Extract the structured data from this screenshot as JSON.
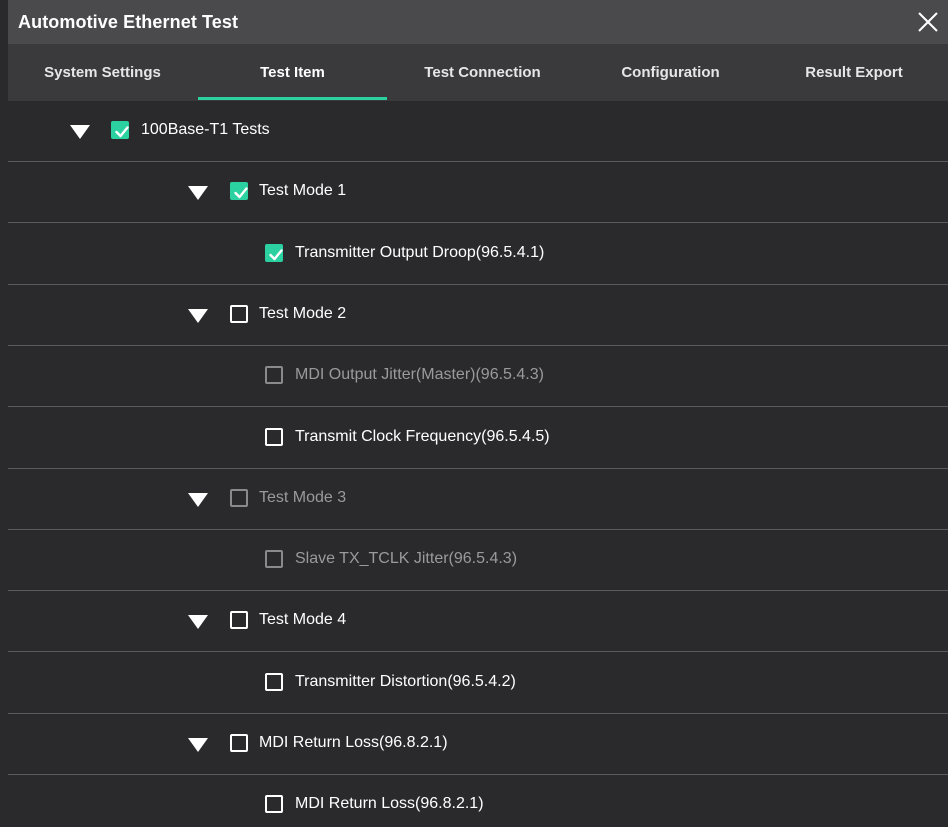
{
  "window": {
    "title": "Automotive Ethernet Test",
    "close_icon": "close-icon"
  },
  "tabs": [
    {
      "label": "System Settings",
      "active": false
    },
    {
      "label": "Test Item",
      "active": true
    },
    {
      "label": "Test Connection",
      "active": false
    },
    {
      "label": "Configuration",
      "active": false
    },
    {
      "label": "Result Export",
      "active": false
    }
  ],
  "colors": {
    "accent": "#2bd1a1",
    "background": "#2a2a2c",
    "titlebar": "#4a4a4c",
    "tabbar": "#3a3a3c",
    "disabled_text": "#9a9a9c"
  },
  "tree": [
    {
      "label": "100Base-T1 Tests",
      "level": 0,
      "expandable": true,
      "checked": true,
      "disabled": false
    },
    {
      "label": "Test Mode 1",
      "level": 1,
      "expandable": true,
      "checked": true,
      "disabled": false
    },
    {
      "label": "Transmitter Output Droop(96.5.4.1)",
      "level": 2,
      "expandable": false,
      "checked": true,
      "disabled": false
    },
    {
      "label": "Test Mode 2",
      "level": 1,
      "expandable": true,
      "checked": false,
      "disabled": false
    },
    {
      "label": "MDI Output Jitter(Master)(96.5.4.3)",
      "level": 2,
      "expandable": false,
      "checked": false,
      "disabled": true
    },
    {
      "label": "Transmit Clock Frequency(96.5.4.5)",
      "level": 2,
      "expandable": false,
      "checked": false,
      "disabled": false
    },
    {
      "label": "Test Mode 3",
      "level": 1,
      "expandable": true,
      "checked": false,
      "disabled": true
    },
    {
      "label": "Slave TX_TCLK Jitter(96.5.4.3)",
      "level": 2,
      "expandable": false,
      "checked": false,
      "disabled": true
    },
    {
      "label": "Test Mode 4",
      "level": 1,
      "expandable": true,
      "checked": false,
      "disabled": false
    },
    {
      "label": "Transmitter Distortion(96.5.4.2)",
      "level": 2,
      "expandable": false,
      "checked": false,
      "disabled": false
    },
    {
      "label": "MDI Return Loss(96.8.2.1)",
      "level": 1,
      "expandable": true,
      "checked": false,
      "disabled": false
    },
    {
      "label": "MDI Return Loss(96.8.2.1)",
      "level": 2,
      "expandable": false,
      "checked": false,
      "disabled": false
    }
  ]
}
